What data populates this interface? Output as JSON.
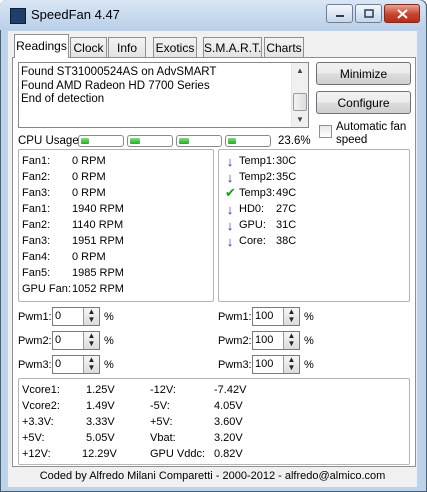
{
  "window": {
    "title": "SpeedFan 4.47"
  },
  "tabs": [
    "Readings",
    "Clock",
    "Info",
    "Exotics",
    "S.M.A.R.T.",
    "Charts"
  ],
  "log": {
    "lines": [
      "Found ST31000524AS on AdvSMART",
      "Found AMD Radeon HD 7700 Series",
      "End of detection"
    ]
  },
  "buttons": {
    "minimize": "Minimize",
    "configure": "Configure"
  },
  "autofan": {
    "label": "Automatic fan speed",
    "checked": false
  },
  "cpu": {
    "label": "CPU Usage",
    "total": "23.6%",
    "core_levels_percent": [
      20,
      25,
      25,
      20
    ]
  },
  "fans": [
    {
      "name": "Fan1:",
      "value": "0 RPM"
    },
    {
      "name": "Fan2:",
      "value": "0 RPM"
    },
    {
      "name": "Fan3:",
      "value": "0 RPM"
    },
    {
      "name": "Fan1:",
      "value": "1940 RPM"
    },
    {
      "name": "Fan2:",
      "value": "1140 RPM"
    },
    {
      "name": "Fan3:",
      "value": "1951 RPM"
    },
    {
      "name": "Fan4:",
      "value": "0 RPM"
    },
    {
      "name": "Fan5:",
      "value": "1985 RPM"
    },
    {
      "name": "GPU Fan:",
      "value": "1052 RPM"
    }
  ],
  "temps": [
    {
      "name": "Temp1:",
      "value": "30C",
      "icon": "arrow-down-icon"
    },
    {
      "name": "Temp2:",
      "value": "35C",
      "icon": "arrow-down-icon"
    },
    {
      "name": "Temp3:",
      "value": "49C",
      "icon": "check-icon"
    },
    {
      "name": "HD0:",
      "value": "27C",
      "icon": "arrow-down-icon"
    },
    {
      "name": "GPU:",
      "value": "31C",
      "icon": "arrow-down-icon"
    },
    {
      "name": "Core:",
      "value": "38C",
      "icon": "arrow-down-icon"
    }
  ],
  "pwm_left": [
    {
      "label": "Pwm1:",
      "value": "0"
    },
    {
      "label": "Pwm2:",
      "value": "0"
    },
    {
      "label": "Pwm3:",
      "value": "0"
    }
  ],
  "pwm_right": [
    {
      "label": "Pwm1:",
      "value": "100"
    },
    {
      "label": "Pwm2:",
      "value": "100"
    },
    {
      "label": "Pwm3:",
      "value": "100"
    }
  ],
  "pwm_unit": "%",
  "volts": {
    "col1": [
      {
        "name": "Vcore1:",
        "value": "1.25V"
      },
      {
        "name": "Vcore2:",
        "value": "1.49V"
      },
      {
        "name": "+3.3V:",
        "value": "3.33V"
      },
      {
        "name": "+5V:",
        "value": "5.05V"
      },
      {
        "name": "+12V:",
        "value": "12.29V"
      }
    ],
    "col2": [
      {
        "name": "-12V:",
        "value": "-7.42V"
      },
      {
        "name": "-5V:",
        "value": "4.05V"
      },
      {
        "name": "+5V:",
        "value": "3.60V"
      },
      {
        "name": "Vbat:",
        "value": "3.20V"
      },
      {
        "name": "GPU Vddc:",
        "value": "0.82V"
      }
    ]
  },
  "footer": "Coded by Alfredo Milani Comparetti - 2000-2012 - alfredo@almico.com",
  "colors": {
    "accent": "#1a2fb0",
    "ok": "#1a9a1a",
    "bar": "#1fae1f"
  }
}
